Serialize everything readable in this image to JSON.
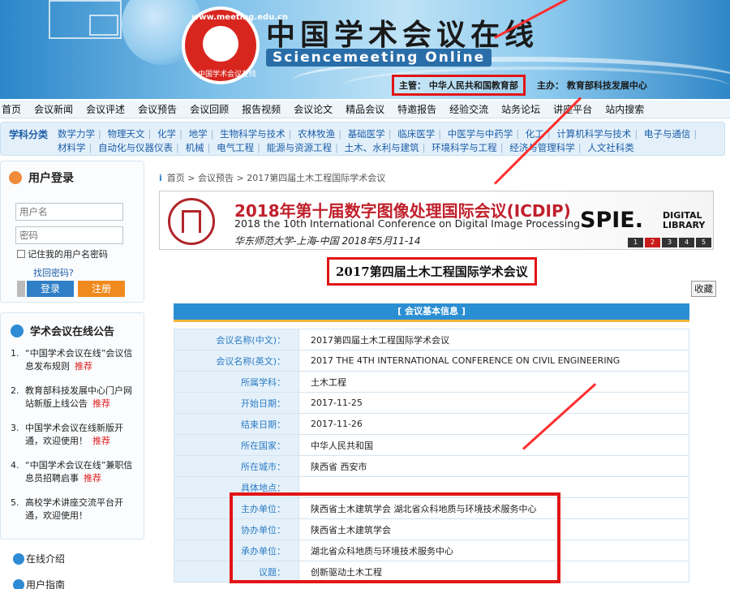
{
  "header": {
    "domain": "www.meeting.edu.cn",
    "logo_arc": "中国学术会议在线",
    "title_cn": "中国学术会议在线",
    "title_en": "Sciencemeeting Online",
    "sponsor": "主管： 中华人民共和国教育部",
    "organizer": "主办： 教育部科技发展中心"
  },
  "main_nav": [
    "首页",
    "会议新闻",
    "会议评述",
    "会议预告",
    "会议回顾",
    "报告视频",
    "会议论文",
    "精品会议",
    "特邀报告",
    "经验交流",
    "站务论坛",
    "讲座平台",
    "站内搜索"
  ],
  "subjects": {
    "label": "学科分类",
    "row1": [
      "数学力学",
      "物理天文",
      "化学",
      "地学",
      "生物科学与技术",
      "农林牧渔",
      "基础医学",
      "临床医学",
      "中医学与中药学",
      "化工",
      "计算机科学与技术",
      "电子与通信"
    ],
    "row2": [
      "材料学",
      "自动化与仪器仪表",
      "机械",
      "电气工程",
      "能源与资源工程",
      "土木、水利与建筑",
      "环境科学与工程",
      "经济与管理科学",
      "人文社科类"
    ]
  },
  "login": {
    "title": "用户登录",
    "username_placeholder": "用户名",
    "password_placeholder": "密码",
    "remember": "记住我的用户名密码",
    "forgot": "找回密码?",
    "login_btn": "登录",
    "register_btn": "注册"
  },
  "announce": {
    "title": "学术会议在线公告",
    "recommend": "推荐",
    "items": [
      {
        "num": "1.",
        "text": "“中国学术会议在线”会议信息发布规则"
      },
      {
        "num": "2.",
        "text": "教育部科技发展中心门户网站新版上线公告"
      },
      {
        "num": "3.",
        "text": "中国学术会议在线新版开通，欢迎使用！"
      },
      {
        "num": "4.",
        "text": "“中国学术会议在线”兼职信息员招聘启事"
      },
      {
        "num": "5.",
        "text": "高校学术讲座交流平台开通，欢迎使用！"
      }
    ]
  },
  "side_links": [
    "在线介绍",
    "用户指南"
  ],
  "breadcrumb": "首页 > 会议预告 > 2017第四届土木工程国际学术会议",
  "ad": {
    "title": "2018年第十届数字图像处理国际会议(ICDIP)",
    "subtitle": "2018 the 10th International Conference on Digital Image Processing",
    "location": "华东师范大学-上海-中国    2018年5月11-14",
    "spie": "SPIE.",
    "spie_dl": "DIGITAL LIBRARY",
    "pages": [
      "1",
      "2",
      "3",
      "4",
      "5"
    ],
    "active_page": "2"
  },
  "conference": {
    "title": "2017第四届土木工程国际学术会议",
    "collect": "收藏",
    "section_header": "[ 会议基本信息 ]",
    "fields": [
      {
        "k": "会议名称(中文)：",
        "v": "2017第四届土木工程国际学术会议"
      },
      {
        "k": "会议名称(英文)：",
        "v": "2017 THE 4TH INTERNATIONAL CONFERENCE ON CIVIL ENGINEERING"
      },
      {
        "k": "所属学科：",
        "v": "土木工程"
      },
      {
        "k": "开始日期：",
        "v": "2017-11-25"
      },
      {
        "k": "结束日期：",
        "v": "2017-11-26"
      },
      {
        "k": "所在国家：",
        "v": "中华人民共和国"
      },
      {
        "k": "所在城市：",
        "v": "陕西省    西安市"
      },
      {
        "k": "具体地点：",
        "v": ""
      },
      {
        "k": "主办单位：",
        "v": "陕西省土木建筑学会 湖北省众科地质与环境技术服务中心"
      },
      {
        "k": "协办单位：",
        "v": "陕西省土木建筑学会"
      },
      {
        "k": "承办单位：",
        "v": "湖北省众科地质与环境技术服务中心"
      },
      {
        "k": "议题：",
        "v": "创新驱动土木工程"
      }
    ]
  },
  "colors": {
    "highlight_red": "#e21515",
    "header_blue": "#2a8ed3",
    "link_blue": "#1d5ea8"
  }
}
